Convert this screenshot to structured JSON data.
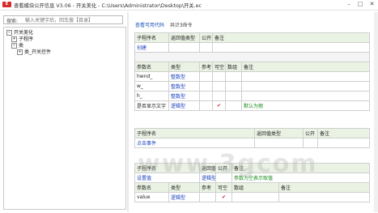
{
  "window": {
    "icon_text": "E",
    "title": "查看模块公开信息 V3.06 - 开关美化 - C:\\Users\\Administrator\\Desktop\\开关.ec",
    "min_glyph": "–",
    "max_glyph": "□",
    "close_glyph": "✕"
  },
  "search": {
    "label": "搜索:",
    "placeholder": "输入关键字后，回车搜【目录】"
  },
  "tree": {
    "nodes": [
      {
        "toggle": "−",
        "label": "开关美化"
      },
      {
        "toggle": "+",
        "label": "子程序"
      },
      {
        "toggle": "−",
        "label": "类"
      },
      {
        "toggle": "+",
        "label": "类_开关控件"
      }
    ]
  },
  "right": {
    "top_link": "查看可用代码",
    "count_text": "共计3命令",
    "table1": {
      "header": [
        "子程序名",
        "返回值类型",
        "公开",
        "备注"
      ],
      "sub_name": "创建",
      "param_header": [
        "参数名",
        "类型",
        "参考",
        "可空",
        "数组",
        "备注"
      ],
      "params": [
        {
          "name": "hwnd_",
          "type": "整数型",
          "ref": "",
          "nullable": "",
          "array": "",
          "note": ""
        },
        {
          "name": "w_",
          "type": "整数型",
          "ref": "",
          "nullable": "",
          "array": "",
          "note": ""
        },
        {
          "name": "h_",
          "type": "整数型",
          "ref": "",
          "nullable": "",
          "array": "",
          "note": ""
        },
        {
          "name": "是否显示文字",
          "type": "逻辑型",
          "ref": "",
          "nullable": "✔",
          "array": "",
          "note": "默认为假"
        }
      ]
    },
    "table2": {
      "header": [
        "子程序名",
        "返回值类型",
        "公开",
        "备注"
      ],
      "sub_name": "点击事件"
    },
    "table3": {
      "header": [
        "子程序名",
        "返回值类型",
        "公开",
        "备注"
      ],
      "sub_name": "设置值",
      "return_type": "逻辑型",
      "note": "参数为空表示取值",
      "param_header": [
        "参数名",
        "类型",
        "参考",
        "可空",
        "数组",
        "备注"
      ],
      "params": [
        {
          "name": "value",
          "type": "逻辑型",
          "ref": "",
          "nullable": "✔",
          "array": "",
          "note": ""
        }
      ]
    },
    "watermark": "www.3gcom"
  }
}
